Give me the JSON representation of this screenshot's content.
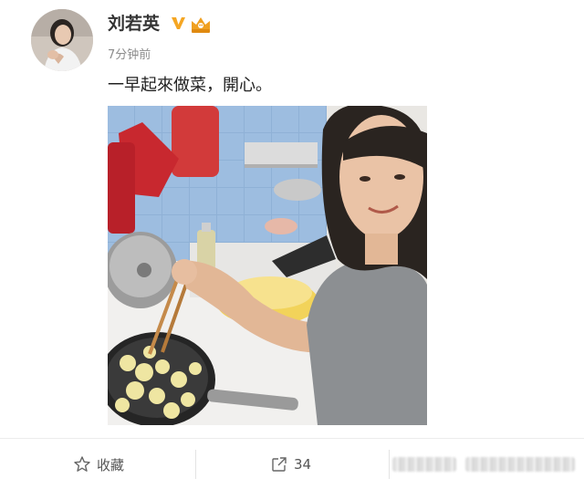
{
  "post": {
    "username": "刘若英",
    "timestamp": "7分钟前",
    "text": "一早起來做菜，開心。"
  },
  "badges": {
    "verified_icon": "verified-v-icon",
    "member_icon": "crown-member-icon",
    "verified_color": "#f5a623",
    "member_color": "#f0a020"
  },
  "actions": {
    "favorite": {
      "icon": "star-outline-icon",
      "label": "收藏"
    },
    "repost": {
      "icon": "share-arrow-icon",
      "count": "34"
    }
  },
  "colors": {
    "username": "#333333",
    "timestamp": "#8c8c8c",
    "action_text": "#555555"
  }
}
